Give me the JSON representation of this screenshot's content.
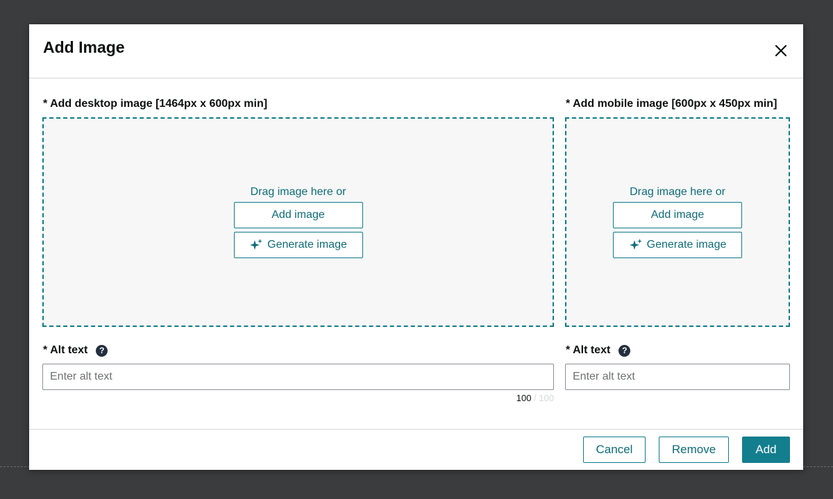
{
  "modal": {
    "title": "Add Image",
    "close_icon": "close-icon"
  },
  "desktop": {
    "label": "* Add desktop image [1464px x 600px min]",
    "drag_text": "Drag image here or",
    "add_button": "Add image",
    "generate_button": "Generate image",
    "alt_label": "* Alt text",
    "alt_placeholder": "Enter alt text",
    "counter_current": "100",
    "counter_separator": " / ",
    "counter_max": "100"
  },
  "mobile": {
    "label": "* Add mobile image [600px x 450px min]",
    "drag_text": "Drag image here or",
    "add_button": "Add image",
    "generate_button": "Generate image",
    "alt_label": "* Alt text",
    "alt_placeholder": "Enter alt text"
  },
  "footer": {
    "cancel": "Cancel",
    "remove": "Remove",
    "add": "Add"
  },
  "help_glyph": "?",
  "colors": {
    "accent": "#0f7b8a",
    "primary_button": "#137e8e",
    "backdrop": "#3b3c3e"
  }
}
